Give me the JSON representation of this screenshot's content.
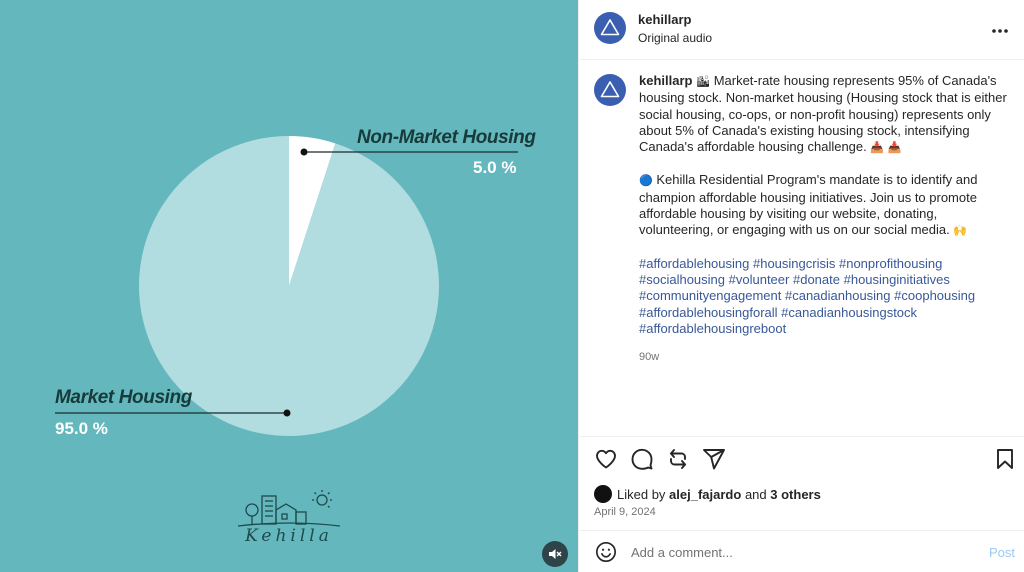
{
  "media": {
    "chart_data": {
      "type": "pie",
      "title": "",
      "slices": [
        {
          "label": "Non-Market Housing",
          "value": 5.0,
          "display": "5.0 %",
          "color": "#ffffff"
        },
        {
          "label": "Market Housing",
          "value": 95.0,
          "display": "95.0 %",
          "color": "#b1dde0"
        }
      ]
    },
    "background_color": "#64b8bd",
    "logo_text": "Kehilla",
    "mute_icon": "speaker-muted-icon"
  },
  "header": {
    "username": "kehillarp",
    "subtitle": "Original audio",
    "more_icon": "more-horizontal-icon"
  },
  "caption": {
    "username": "kehillarp",
    "para1": "Market-rate housing represents 95% of Canada's housing stock. Non-market housing (Housing stock that is either social housing, co-ops, or non-profit housing) represents only about 5% of Canada's existing housing stock, intensifying Canada's affordable housing challenge.",
    "para1_lead_emoji": "🏙",
    "para1_trail_emoji": "📥 📥",
    "para2_emoji": "🔵",
    "para2": "Kehilla Residential Program's mandate is to identify and champion affordable housing initiatives. Join us to promote affordable housing by visiting our website, donating, volunteering, or engaging with us on our social media.",
    "para2_trail_emoji": "🙌",
    "hashtags": [
      "#affordablehousing",
      "#housingcrisis",
      "#nonprofithousing",
      "#socialhousing",
      "#volunteer",
      "#donate",
      "#housinginitiatives",
      "#communityengagement",
      "#canadianhousing",
      "#coophousing",
      "#affordablehousingforall",
      "#canadianhousingstock",
      "#affordablehousingreboot"
    ],
    "time_ago": "90w"
  },
  "actions": {
    "like_icon": "heart-icon",
    "comment_icon": "comment-icon",
    "repost_icon": "repost-icon",
    "share_icon": "send-icon",
    "save_icon": "bookmark-icon",
    "liked_by_prefix": "Liked by",
    "liked_by_user": "alej_fajardo",
    "liked_by_and": "and",
    "liked_by_others": "3 others",
    "date": "April 9, 2024"
  },
  "comment": {
    "emoji_icon": "smiley-icon",
    "placeholder": "Add a comment...",
    "post_label": "Post",
    "post_color": "#9cc9f5"
  }
}
